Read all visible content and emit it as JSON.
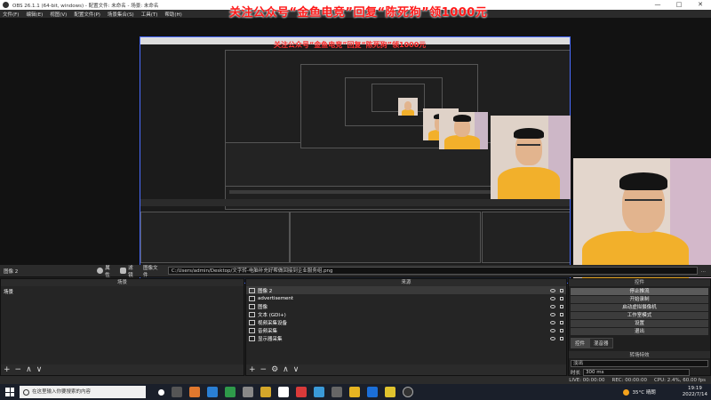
{
  "window": {
    "title": "OBS 26.1.1 (64-bit, windows) - 配置文件: 未命名 - 场景: 未命名",
    "minimize": "—",
    "maximize": "□",
    "close": "✕"
  },
  "banner": "关注公众号“金鱼电竞”回复“陈死狗”领1000元",
  "menu": [
    "文件(F)",
    "编辑(E)",
    "视图(V)",
    "配置文件(P)",
    "场景集合(S)",
    "工具(T)",
    "帮助(H)"
  ],
  "nested_banner": "关注公众号“金鱼电竞”回复“陈死狗”领1000元",
  "controls": {
    "source_name": "图像 2",
    "properties": "属性",
    "filters": "滤镜",
    "image_file_label": "图像文件",
    "image_path": "C:/Users/admin/Desktop/文字转-电脑补充好帮做回接到企业服务组.png",
    "more": "..."
  },
  "scenes_dock": {
    "title": "场景",
    "items": [
      "场景"
    ],
    "footer": [
      "+",
      "−",
      "∧",
      "∨"
    ]
  },
  "sources_dock": {
    "title": "来源",
    "items": [
      {
        "icon": "image-icon",
        "label": "图像 2"
      },
      {
        "icon": "text-icon",
        "label": "advertisement"
      },
      {
        "icon": "image-icon",
        "label": "图像"
      },
      {
        "icon": "text-icon",
        "label": "文本 (GDI+)"
      },
      {
        "icon": "camera-icon",
        "label": "视频采集设备"
      },
      {
        "icon": "monitor-icon",
        "label": "音频采集"
      },
      {
        "icon": "monitor-icon",
        "label": "显示器采集"
      }
    ],
    "footer": [
      "+",
      "−",
      "⚙",
      "∧",
      "∨"
    ]
  },
  "controls_dock": {
    "title": "控件",
    "buttons": [
      "停止推流",
      "开始录制",
      "启动虚拟摄像机",
      "工作室模式",
      "设置",
      "退出"
    ],
    "tabs": [
      "控件",
      "混音器"
    ],
    "transitions_title": "转场特效",
    "transition_value": "淡出",
    "duration_label": "时长",
    "duration_value": "300 ms"
  },
  "statusbar": {
    "live": "LIVE: 00:00:00",
    "rec": "REC: 00:00:00",
    "cpu": "CPU: 2.4%, 60.00 fps"
  },
  "taskbar": {
    "search_placeholder": "在这里输入你要搜索的内容",
    "weather": "35°C 晴朗",
    "time": "19:19",
    "date": "2022/7/14"
  },
  "colors": {
    "banner": "#ff1a1a",
    "selection_border": "#4a6cff",
    "shirt": "#f2b02b"
  }
}
